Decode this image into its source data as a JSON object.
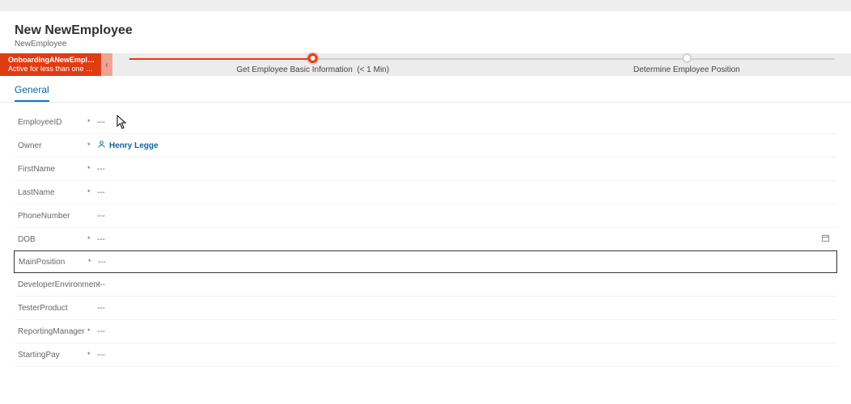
{
  "header": {
    "title": "New NewEmployee",
    "subtitle": "NewEmployee"
  },
  "stage": {
    "tag_line1": "OnboardingANewEmplo...",
    "tag_line2": "Active for less than one mi...",
    "nodes": [
      {
        "label": "Get Employee Basic Information",
        "time": "(< 1 Min)",
        "active": true
      },
      {
        "label": "Determine Employee Position",
        "time": "",
        "active": false
      }
    ]
  },
  "tabs": [
    {
      "label": "General",
      "active": true
    }
  ],
  "empty_dash": "---",
  "required_mark": "*",
  "owner_value": "Henry Legge",
  "fields": [
    {
      "key": "employee_id",
      "label": "EmployeeID",
      "required": true,
      "value": "---"
    },
    {
      "key": "owner",
      "label": "Owner",
      "required": true,
      "type": "owner"
    },
    {
      "key": "first_name",
      "label": "FirstName",
      "required": true,
      "value": "---"
    },
    {
      "key": "last_name",
      "label": "LastName",
      "required": true,
      "value": "---"
    },
    {
      "key": "phone",
      "label": "PhoneNumber",
      "required": false,
      "value": "---"
    },
    {
      "key": "dob",
      "label": "DOB",
      "required": true,
      "value": "---",
      "type": "date"
    },
    {
      "key": "main_pos",
      "label": "MainPosition",
      "required": true,
      "value": "---",
      "selected": true
    },
    {
      "key": "dev_env",
      "label": "DeveloperEnvironment",
      "required": false,
      "value": "---"
    },
    {
      "key": "tester_prod",
      "label": "TesterProduct",
      "required": false,
      "value": "---"
    },
    {
      "key": "rep_mgr",
      "label": "ReportingManager",
      "required": true,
      "value": "---"
    },
    {
      "key": "start_pay",
      "label": "StartingPay",
      "required": true,
      "value": "---"
    }
  ]
}
